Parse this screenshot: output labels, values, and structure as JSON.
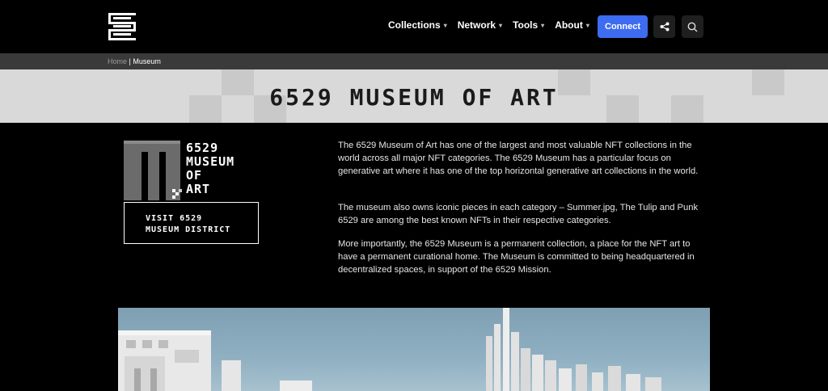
{
  "header": {
    "nav": [
      {
        "label": "Collections"
      },
      {
        "label": "Network"
      },
      {
        "label": "Tools"
      },
      {
        "label": "About"
      }
    ],
    "connect_label": "Connect"
  },
  "breadcrumb": {
    "home": "Home",
    "separator": " | ",
    "current": "Museum"
  },
  "banner": {
    "title": "6529 MUSEUM OF ART"
  },
  "museum_logo": {
    "lines": [
      "6529",
      "MUSEUM",
      "OF",
      "ART"
    ]
  },
  "visit_button": {
    "line1": "VISIT 6529",
    "line2": "MUSEUM DISTRICT"
  },
  "content": {
    "paragraph1": "The 6529 Museum of Art has one of the largest and most valuable NFT collections in the world across all major NFT categories. The 6529 Museum has a particular focus on generative art where it has one of the top horizontal generative art collections in the world.",
    "paragraph2": "The museum also owns iconic pieces in each category – Summer.jpg, The Tulip and Punk 6529 are among the best known NFTs in their respective categories.",
    "paragraph3": "More importantly, the 6529 Museum is a permanent collection, a place for the NFT art to have a permanent curational home. The Museum is committed to being headquartered in decentralized spaces, in support of the 6529 Mission."
  },
  "colors": {
    "accent": "#3d6cf0",
    "background": "#000000",
    "banner": "#d9d9d9",
    "breadcrumb_bar": "#3a3a3a"
  },
  "icons": {
    "logo": "6529-logo",
    "share": "share-icon",
    "search": "search-icon",
    "caret": "chevron-down-icon"
  }
}
